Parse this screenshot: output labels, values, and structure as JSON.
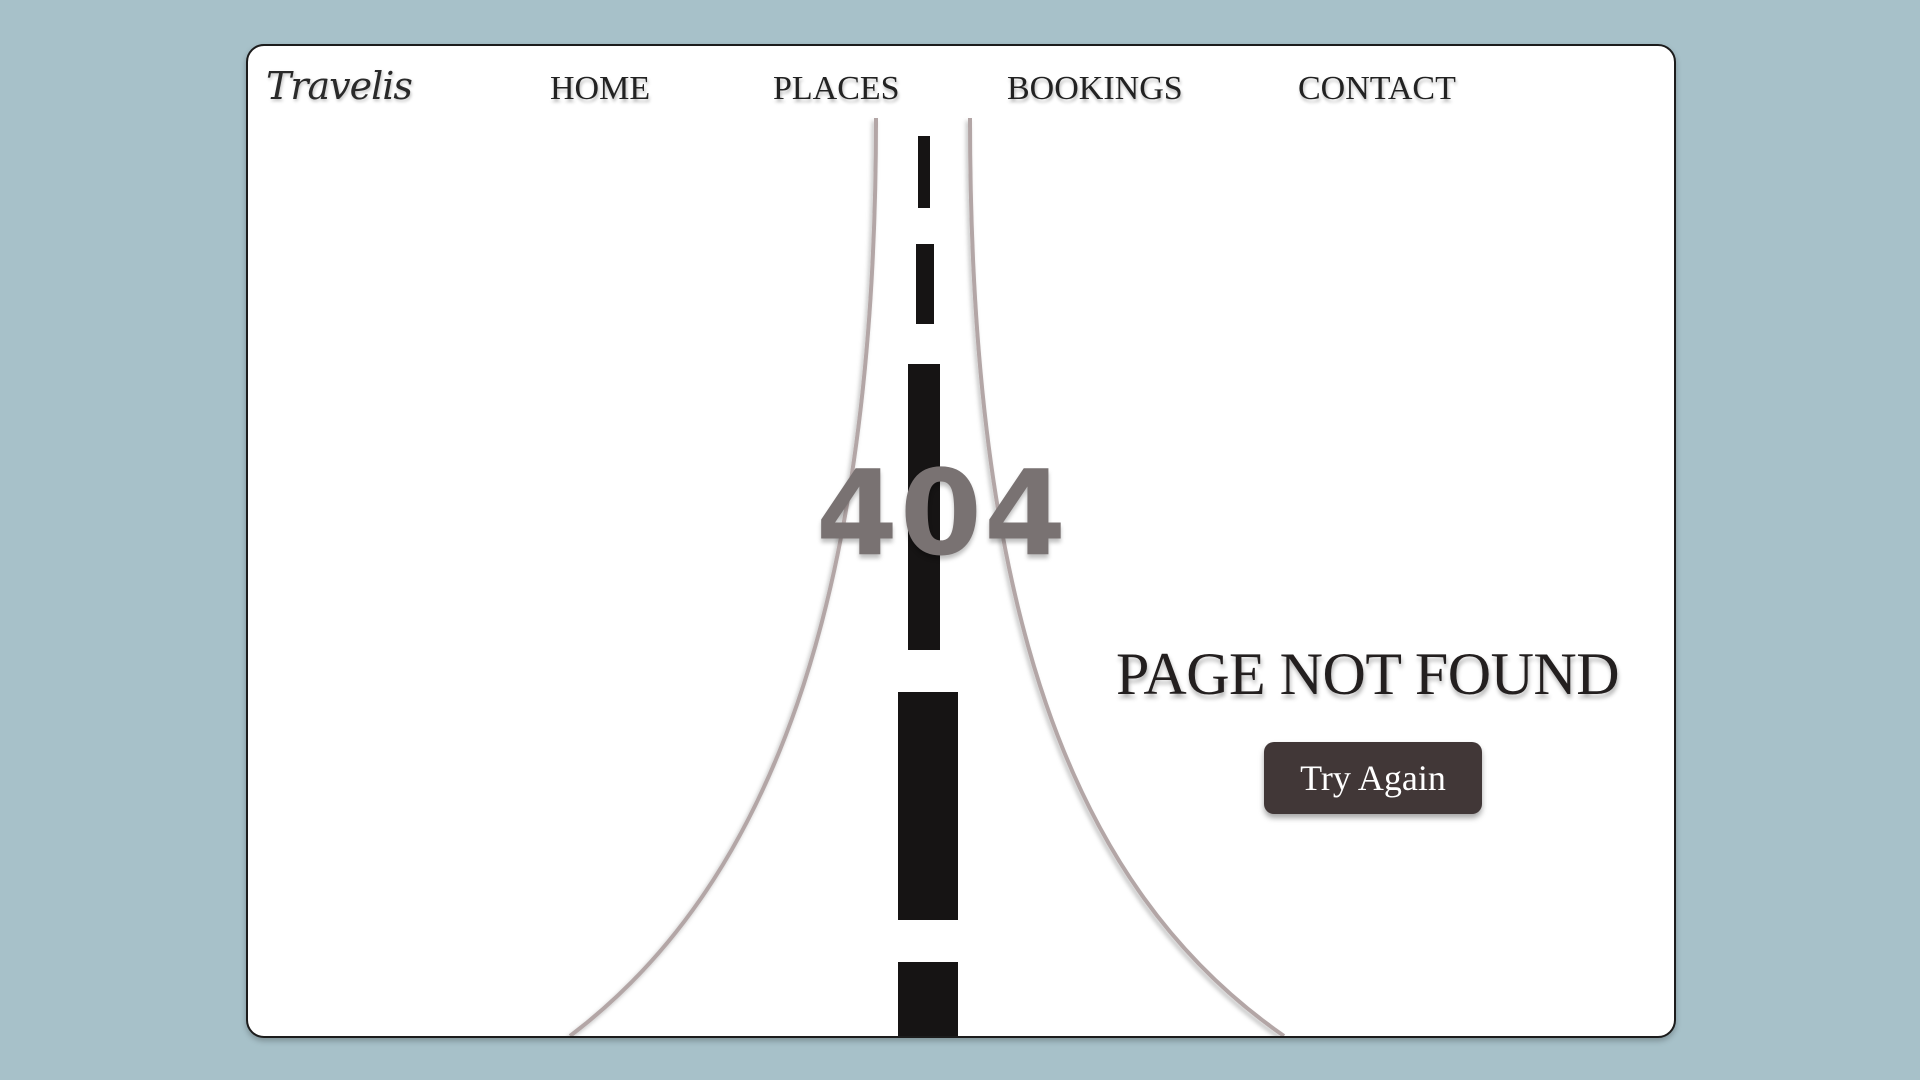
{
  "brand": {
    "logo": "Travelis"
  },
  "nav": {
    "items": [
      "HOME",
      "PLACES",
      "BOOKINGS",
      "CONTACT"
    ]
  },
  "error": {
    "code": "404",
    "message": "PAGE NOT FOUND",
    "button_label": "Try Again"
  },
  "colors": {
    "background": "#a7c1c9",
    "page": "#ffffff",
    "button": "#413737",
    "code_text": "#797272",
    "road_edge": "#b3a6a6",
    "lane_marking": "#161414"
  },
  "icons": {
    "illustration": "road-illustration"
  }
}
